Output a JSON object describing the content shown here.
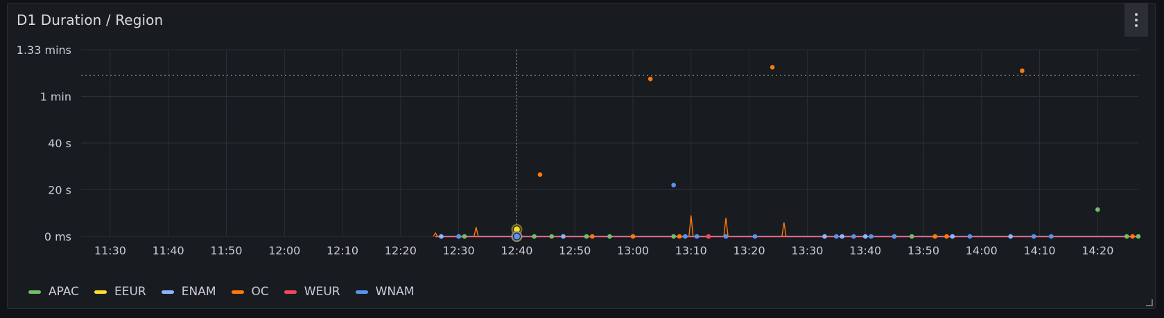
{
  "panel": {
    "title": "D1 Duration / Region",
    "menu_icon": "more-vertical-icon"
  },
  "chart_data": {
    "type": "line",
    "title": "D1 Duration / Region",
    "y_axis": {
      "range_seconds": [
        0,
        80
      ],
      "tick_values_seconds": [
        0,
        20,
        40,
        60,
        80
      ],
      "tick_labels": [
        "0 ms",
        "20 s",
        "40 s",
        "1 min",
        "1.33 mins"
      ]
    },
    "x_axis": {
      "tick_labels": [
        "11:30",
        "11:40",
        "11:50",
        "12:00",
        "12:10",
        "12:20",
        "12:30",
        "12:40",
        "12:50",
        "13:00",
        "13:10",
        "13:20",
        "13:30",
        "13:40",
        "13:50",
        "14:00",
        "14:10",
        "14:20"
      ]
    },
    "threshold_seconds": 69,
    "hover_time": "12:40",
    "grid": true,
    "legend_position": "bottom-left",
    "series": [
      {
        "name": "APAC",
        "color": "#73bf69",
        "points": [
          [
            "12:31",
            0
          ],
          [
            "12:43",
            0
          ],
          [
            "12:46",
            0
          ],
          [
            "12:52",
            0
          ],
          [
            "12:56",
            0
          ],
          [
            "13:07",
            0
          ],
          [
            "13:48",
            0
          ],
          [
            "14:20",
            11.5
          ],
          [
            "14:25",
            0
          ],
          [
            "14:27",
            0
          ]
        ]
      },
      {
        "name": "EEUR",
        "color": "#fade2a",
        "points": [
          [
            "12:40",
            3
          ],
          [
            "12:40",
            0
          ]
        ]
      },
      {
        "name": "ENAM",
        "color": "#8ab8ff",
        "points": [
          [
            "12:27",
            0
          ],
          [
            "12:30",
            0
          ],
          [
            "12:48",
            0
          ],
          [
            "13:33",
            0
          ],
          [
            "13:36",
            0
          ],
          [
            "13:40",
            0
          ],
          [
            "13:55",
            0
          ],
          [
            "14:05",
            0
          ]
        ]
      },
      {
        "name": "OC",
        "color": "#ff780a",
        "points": [
          [
            "12:40",
            0
          ],
          [
            "12:44",
            26.5
          ],
          [
            "12:53",
            0
          ],
          [
            "13:00",
            0
          ],
          [
            "13:03",
            67.5
          ],
          [
            "13:08",
            0
          ],
          [
            "13:24",
            72.5
          ],
          [
            "13:45",
            0
          ],
          [
            "13:52",
            0
          ],
          [
            "13:54",
            0
          ],
          [
            "14:07",
            71
          ],
          [
            "14:26",
            0
          ]
        ]
      },
      {
        "name": "WEUR",
        "color": "#f2495c",
        "points": [
          [
            "13:13",
            0
          ]
        ]
      },
      {
        "name": "WNAM",
        "color": "#5794f2",
        "points": [
          [
            "12:40",
            0
          ],
          [
            "12:30",
            0
          ],
          [
            "13:07",
            22
          ],
          [
            "13:09",
            0
          ],
          [
            "13:11",
            0
          ],
          [
            "13:16",
            0
          ],
          [
            "13:21",
            0
          ],
          [
            "13:35",
            0
          ],
          [
            "13:38",
            0
          ],
          [
            "13:41",
            0
          ],
          [
            "13:45",
            0
          ],
          [
            "13:58",
            0
          ],
          [
            "14:09",
            0
          ],
          [
            "14:12",
            0
          ]
        ]
      }
    ],
    "spikes": [
      {
        "series": "OC",
        "time": "12:26",
        "value": 1.5
      },
      {
        "series": "OC",
        "time": "12:33",
        "value": 4
      },
      {
        "series": "OC",
        "time": "13:10",
        "value": 9
      },
      {
        "series": "OC",
        "time": "13:16",
        "value": 8
      },
      {
        "series": "OC",
        "time": "13:26",
        "value": 6
      }
    ]
  }
}
